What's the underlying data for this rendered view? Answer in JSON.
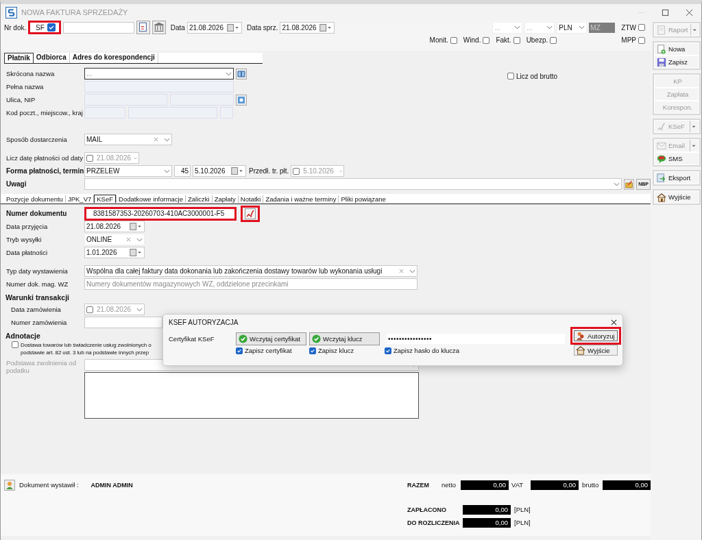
{
  "window": {
    "title": "NOWA FAKTURA SPRZEDAŻY"
  },
  "header": {
    "number_label": "Nr dok.",
    "series": "SF",
    "series_checked": true,
    "series_highlighted": true,
    "date_label": "Data",
    "date": "21.08.2026",
    "sale_date_label": "Data sprz.",
    "sale_date": "21.08.2026",
    "selectors": [
      {
        "value": "...",
        "disabled": true
      },
      {
        "value": "...",
        "disabled": true
      },
      {
        "value": "PLN",
        "disabled": false
      }
    ],
    "rate": "MZ",
    "top_flags": [
      {
        "label": "ZTW",
        "checked": false
      }
    ],
    "flags": [
      {
        "label": "Monit.",
        "checked": false
      },
      {
        "label": "Wind.",
        "checked": false
      },
      {
        "label": "Fakt.",
        "checked": false
      },
      {
        "label": "Ubezp.",
        "checked": false
      }
    ],
    "mpp": {
      "label": "MPP",
      "checked": false
    }
  },
  "party": {
    "tabs": [
      {
        "label": "Płatnik",
        "selected": true
      },
      {
        "label": "Odbiorca",
        "selected": false
      },
      {
        "label": "Adres do korespondencji",
        "selected": false
      }
    ],
    "fields": [
      {
        "label": "Skrócona nazwa",
        "kind": "combo",
        "placeholder": "..."
      },
      {
        "label": "Pełna nazwa",
        "kind": "plain"
      },
      {
        "label": "Ulica, NIP",
        "kind": "split2"
      },
      {
        "label": "Kod poczt., miejscow., kraj",
        "kind": "split3"
      }
    ],
    "gross": {
      "label": "Licz od brutto",
      "checked": false
    }
  },
  "delivery": {
    "label": "Sposób dostarczenia",
    "value": "MAIL"
  },
  "payment_from": {
    "label": "Licz datę płatności od daty",
    "checked": false,
    "date": "21.08.2026"
  },
  "payment": {
    "label": "Forma płatności, termin",
    "method": "PRZELEW",
    "days": "45",
    "due": "5.10.2026",
    "ext_label": "Przedł. tr. płt.",
    "ext_checked": false,
    "ext_date": "5.10.2026"
  },
  "notes": {
    "label": "Uwagi",
    "nbp": "NBP"
  },
  "doc_tabs": [
    {
      "label": "Pozycje dokumentu",
      "selected": false
    },
    {
      "label": "JPK_V7",
      "selected": false
    },
    {
      "label": "KSeF",
      "selected": true
    },
    {
      "label": "Dodatkowe informacje",
      "selected": false
    },
    {
      "label": "Zaliczki",
      "selected": false
    },
    {
      "label": "Zapłaty",
      "selected": false
    },
    {
      "label": "Notatki",
      "selected": false
    },
    {
      "label": "Zadania i ważne terminy",
      "selected": false
    },
    {
      "label": "Pliki powiązane",
      "selected": false
    }
  ],
  "ksef": {
    "number_label": "Numer dokumentu",
    "number": "8381587353-20260703-410AC3000001-F5",
    "number_highlighted": true,
    "icon_highlighted": true,
    "fields": [
      {
        "label": "Data przyjęcia",
        "kind": "date",
        "value": "21.08.2026"
      },
      {
        "label": "Tryb wysyłki",
        "kind": "combo",
        "value": "ONLINE"
      },
      {
        "label": "Data płatności",
        "kind": "date",
        "value": "1.01.2026"
      }
    ],
    "issue_type": {
      "label": "Typ daty wystawienia",
      "value": "Wspólna dla całej faktury data dokonania lub zakończenia dostawy towarów lub wykonania usługi"
    },
    "wz": {
      "label": "Numer dok. mag. WZ",
      "placeholder": "Numery dokumentów magazynowych WZ, oddzielone przecinkami"
    },
    "terms": {
      "title": "Warunki transakcji",
      "order_date_label": "Data zamówienia",
      "order_date_checked": false,
      "order_date": "21.08.2026",
      "order_number_label": "Numer zamówienia"
    },
    "annotations": {
      "title": "Adnotacje",
      "exempt_checked": false,
      "exempt_lines": [
        "Dostawa towarów lub świadczenie usług zwolnionych o",
        "podstawie art. 82 ust. 3 lub na podstawie innych przep"
      ],
      "basis_label": "Podstawa zwolnienia od podatku"
    }
  },
  "footer": {
    "issued_label": "Dokument wystawił :",
    "issued_by": "ADMIN ADMIN",
    "total_label": "RAZEM",
    "net_label": "netto",
    "net": "0,00",
    "vat_label": "VAT",
    "vat": "0,00",
    "gross_label": "brutto",
    "gross": "0,00",
    "paid_label": "ZAPŁACONO",
    "paid": "0,00",
    "paid_currency": "[PLN]",
    "due_label": "DO ROZLICZENIA",
    "due": "0,00",
    "due_currency": "[PLN]"
  },
  "side_groups": [
    [
      {
        "label": "Raport",
        "disabled": true,
        "dropdown": true,
        "kind": "report"
      }
    ],
    [
      {
        "label": "Nowa",
        "disabled": false,
        "dropdown": false,
        "kind": "new"
      },
      {
        "label": "Zapisz",
        "disabled": false,
        "dropdown": false,
        "kind": "save"
      }
    ],
    [
      {
        "label": "KP",
        "disabled": true,
        "dropdown": false
      },
      {
        "label": "Zapłata",
        "disabled": true,
        "dropdown": false
      },
      {
        "label": "Korespon.",
        "disabled": true,
        "dropdown": false
      }
    ],
    [
      {
        "label": "KSeF",
        "disabled": true,
        "dropdown": true,
        "kind": "ksef"
      }
    ],
    [
      {
        "label": "Email",
        "disabled": true,
        "dropdown": true,
        "kind": "mail"
      },
      {
        "label": "SMS",
        "disabled": false,
        "dropdown": false,
        "kind": "sms"
      }
    ],
    [
      {
        "label": "Eksport",
        "disabled": false,
        "dropdown": false,
        "kind": "export"
      }
    ],
    [
      {
        "label": "Wyjście",
        "disabled": false,
        "dropdown": false,
        "kind": "home"
      }
    ]
  ],
  "dialog": {
    "title": "KSEF AUTORYZACJA",
    "cert_label": "Certyfikat KSeF",
    "loads": [
      {
        "label": "Wczytaj certyfikat",
        "loaded": true
      },
      {
        "label": "Wczytaj klucz",
        "loaded": true
      }
    ],
    "password": "••••••••••••••••",
    "saves": [
      {
        "label": "Zapisz certyfikat",
        "checked": true
      },
      {
        "label": "Zapisz klucz",
        "checked": true
      },
      {
        "label": "Zapisz hasło do klucza",
        "checked": true
      }
    ],
    "authorize": {
      "label": "Autoryzuj",
      "highlighted": true
    },
    "exit": "Wyjście"
  }
}
